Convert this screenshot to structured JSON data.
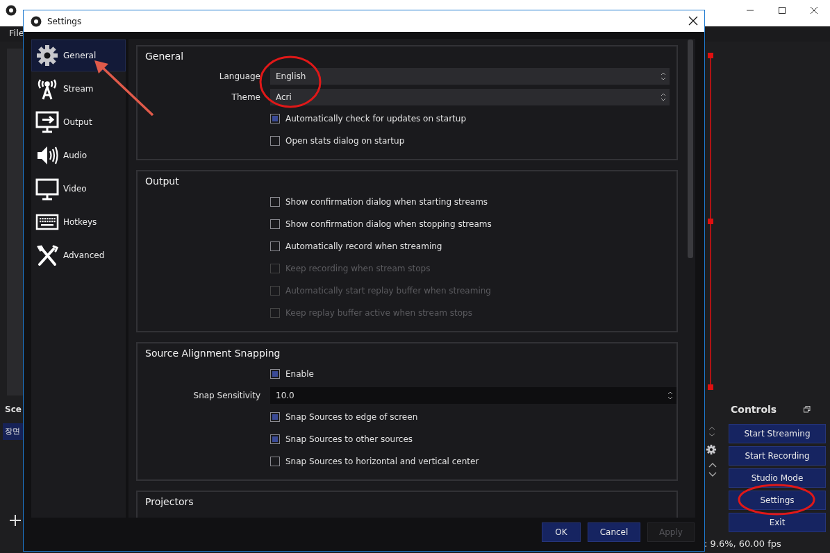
{
  "main_window": {
    "menu": [
      "File"
    ],
    "scenes": {
      "title": "Sce",
      "items": [
        {
          "label": "장면",
          "selected": true
        }
      ]
    },
    "controls": {
      "title": "Controls",
      "buttons": [
        "Start Streaming",
        "Start Recording",
        "Studio Mode",
        "Settings",
        "Exit"
      ]
    },
    "status_bar": ": 9.6%, 60.00 fps"
  },
  "settings_dialog": {
    "title": "Settings",
    "sidebar": [
      {
        "label": "General",
        "selected": true
      },
      {
        "label": "Stream",
        "selected": false
      },
      {
        "label": "Output",
        "selected": false
      },
      {
        "label": "Audio",
        "selected": false
      },
      {
        "label": "Video",
        "selected": false
      },
      {
        "label": "Hotkeys",
        "selected": false
      },
      {
        "label": "Advanced",
        "selected": false
      }
    ],
    "sections": [
      {
        "title": "General",
        "rows": [
          {
            "kind": "select",
            "label": "Language",
            "value": "English"
          },
          {
            "kind": "select",
            "label": "Theme",
            "value": "Acri"
          },
          {
            "kind": "checkbox",
            "label": "Automatically check for updates on startup",
            "checked": true,
            "disabled": false
          },
          {
            "kind": "checkbox",
            "label": "Open stats dialog on startup",
            "checked": false,
            "disabled": false
          }
        ]
      },
      {
        "title": "Output",
        "rows": [
          {
            "kind": "checkbox",
            "label": "Show confirmation dialog when starting streams",
            "checked": false,
            "disabled": false
          },
          {
            "kind": "checkbox",
            "label": "Show confirmation dialog when stopping streams",
            "checked": false,
            "disabled": false
          },
          {
            "kind": "checkbox",
            "label": "Automatically record when streaming",
            "checked": false,
            "disabled": false
          },
          {
            "kind": "checkbox",
            "label": "Keep recording when stream stops",
            "checked": false,
            "disabled": true
          },
          {
            "kind": "checkbox",
            "label": "Automatically start replay buffer when streaming",
            "checked": false,
            "disabled": true
          },
          {
            "kind": "checkbox",
            "label": "Keep replay buffer active when stream stops",
            "checked": false,
            "disabled": true
          }
        ]
      },
      {
        "title": "Source Alignment Snapping",
        "rows": [
          {
            "kind": "checkbox",
            "label": "Enable",
            "checked": true,
            "disabled": false
          },
          {
            "kind": "spin",
            "label": "Snap Sensitivity",
            "value": "10.0"
          },
          {
            "kind": "checkbox",
            "label": "Snap Sources to edge of screen",
            "checked": true,
            "disabled": false
          },
          {
            "kind": "checkbox",
            "label": "Snap Sources to other sources",
            "checked": true,
            "disabled": false
          },
          {
            "kind": "checkbox",
            "label": "Snap Sources to horizontal and vertical center",
            "checked": false,
            "disabled": false
          }
        ]
      },
      {
        "title": "Projectors"
      }
    ],
    "buttons": [
      {
        "label": "OK",
        "disabled": false
      },
      {
        "label": "Cancel",
        "disabled": false
      },
      {
        "label": "Apply",
        "disabled": true
      }
    ]
  },
  "annotations": [
    {
      "kind": "ellipse"
    },
    {
      "kind": "ellipse"
    },
    {
      "kind": "arrow"
    }
  ]
}
